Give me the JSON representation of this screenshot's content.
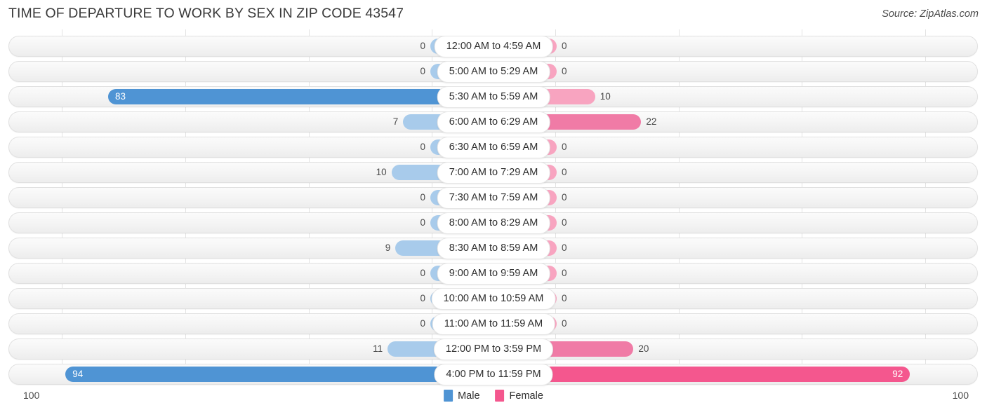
{
  "header": {
    "title": "TIME OF DEPARTURE TO WORK BY SEX IN ZIP CODE 43547",
    "source": "Source: ZipAtlas.com"
  },
  "legend": {
    "male_label": "Male",
    "female_label": "Female",
    "male_color": "#4f94d4",
    "female_color": "#f4578e"
  },
  "axis": {
    "left_label": "100",
    "right_label": "100"
  },
  "chart_data": {
    "type": "bar",
    "title": "TIME OF DEPARTURE TO WORK BY SEX IN ZIP CODE 43547",
    "subtitle": "",
    "xlabel": "",
    "ylabel": "",
    "orientation": "horizontal-diverging",
    "xlim": [
      0,
      100
    ],
    "grid": true,
    "legend_position": "bottom-center",
    "categories": [
      "12:00 AM to 4:59 AM",
      "5:00 AM to 5:29 AM",
      "5:30 AM to 5:59 AM",
      "6:00 AM to 6:29 AM",
      "6:30 AM to 6:59 AM",
      "7:00 AM to 7:29 AM",
      "7:30 AM to 7:59 AM",
      "8:00 AM to 8:29 AM",
      "8:30 AM to 8:59 AM",
      "9:00 AM to 9:59 AM",
      "10:00 AM to 10:59 AM",
      "11:00 AM to 11:59 AM",
      "12:00 PM to 3:59 PM",
      "4:00 PM to 11:59 PM"
    ],
    "series": [
      {
        "name": "Male",
        "color": "#4f94d4",
        "values": [
          0,
          0,
          83,
          7,
          0,
          10,
          0,
          0,
          9,
          0,
          0,
          0,
          11,
          94
        ]
      },
      {
        "name": "Female",
        "color": "#f4578e",
        "values": [
          0,
          0,
          10,
          22,
          0,
          0,
          0,
          0,
          0,
          0,
          0,
          0,
          20,
          92
        ]
      }
    ]
  },
  "rows": [
    {
      "category": "12:00 AM to 4:59 AM",
      "male": "0",
      "female": "0"
    },
    {
      "category": "5:00 AM to 5:29 AM",
      "male": "0",
      "female": "0"
    },
    {
      "category": "5:30 AM to 5:59 AM",
      "male": "83",
      "female": "10"
    },
    {
      "category": "6:00 AM to 6:29 AM",
      "male": "7",
      "female": "22"
    },
    {
      "category": "6:30 AM to 6:59 AM",
      "male": "0",
      "female": "0"
    },
    {
      "category": "7:00 AM to 7:29 AM",
      "male": "10",
      "female": "0"
    },
    {
      "category": "7:30 AM to 7:59 AM",
      "male": "0",
      "female": "0"
    },
    {
      "category": "8:00 AM to 8:29 AM",
      "male": "0",
      "female": "0"
    },
    {
      "category": "8:30 AM to 8:59 AM",
      "male": "9",
      "female": "0"
    },
    {
      "category": "9:00 AM to 9:59 AM",
      "male": "0",
      "female": "0"
    },
    {
      "category": "10:00 AM to 10:59 AM",
      "male": "0",
      "female": "0"
    },
    {
      "category": "11:00 AM to 11:59 AM",
      "male": "0",
      "female": "0"
    },
    {
      "category": "12:00 PM to 3:59 PM",
      "male": "11",
      "female": "20"
    },
    {
      "category": "4:00 PM to 11:59 PM",
      "male": "94",
      "female": "92"
    }
  ]
}
